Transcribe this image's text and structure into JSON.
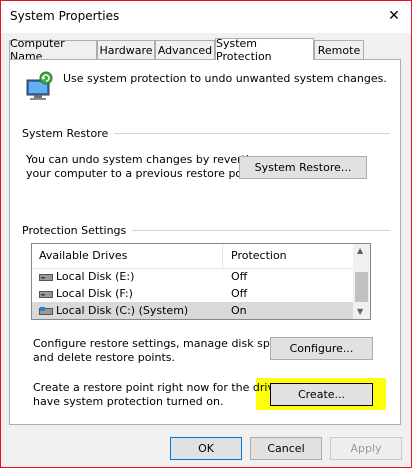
{
  "window": {
    "title": "System Properties",
    "close_glyph": "✕"
  },
  "tabs": [
    {
      "label": "Computer Name",
      "active": false
    },
    {
      "label": "Hardware",
      "active": false
    },
    {
      "label": "Advanced",
      "active": false
    },
    {
      "label": "System Protection",
      "active": true
    },
    {
      "label": "Remote",
      "active": false
    }
  ],
  "intro": {
    "icon": "system-protection-icon",
    "text": "Use system protection to undo unwanted system changes."
  },
  "system_restore": {
    "heading": "System Restore",
    "description_line1": "You can undo system changes by reverting",
    "description_line2": "your computer to a previous restore point.",
    "button": "System Restore..."
  },
  "protection_settings": {
    "heading": "Protection Settings",
    "columns": [
      "Available Drives",
      "Protection"
    ],
    "drives": [
      {
        "name": "Local Disk (E:)",
        "protection": "Off",
        "icon": "drive-icon",
        "selected": false
      },
      {
        "name": "Local Disk (F:)",
        "protection": "Off",
        "icon": "drive-icon",
        "selected": false
      },
      {
        "name": "Local Disk (C:) (System)",
        "protection": "On",
        "icon": "system-drive-icon",
        "selected": true
      }
    ]
  },
  "configure": {
    "line1": "Configure restore settings, manage disk space,",
    "line2": "and delete restore points.",
    "button": "Configure..."
  },
  "create": {
    "line1": "Create a restore point right now for the drives that",
    "line2": "have system protection turned on.",
    "button": "Create..."
  },
  "footer": {
    "ok": "OK",
    "cancel": "Cancel",
    "apply": "Apply"
  },
  "colors": {
    "window_border": "#e81123",
    "highlight": "#ffff00",
    "selected_row": "#d9d9d9"
  }
}
